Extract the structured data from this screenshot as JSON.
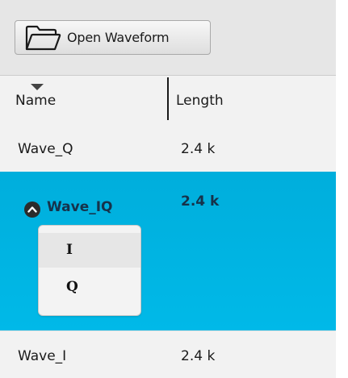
{
  "toolbar": {
    "open_button_label": "Open Waveform",
    "open_button_icon": "folder-open-icon"
  },
  "table": {
    "columns": [
      {
        "label": "Name",
        "sort": "descending"
      },
      {
        "label": "Length"
      }
    ],
    "rows": [
      {
        "name": "Wave_Q",
        "length": "2.4 k",
        "selected": false
      },
      {
        "name": "Wave_IQ",
        "length": "2.4 k",
        "selected": true,
        "expanded": true,
        "channels": [
          "I",
          "Q"
        ]
      },
      {
        "name": "Wave_I",
        "length": "2.4 k",
        "selected": false
      }
    ]
  },
  "colors": {
    "selection": "#00b4e4",
    "toolbar_bg": "#e6e6e6",
    "row_bg": "#f2f2f2"
  }
}
